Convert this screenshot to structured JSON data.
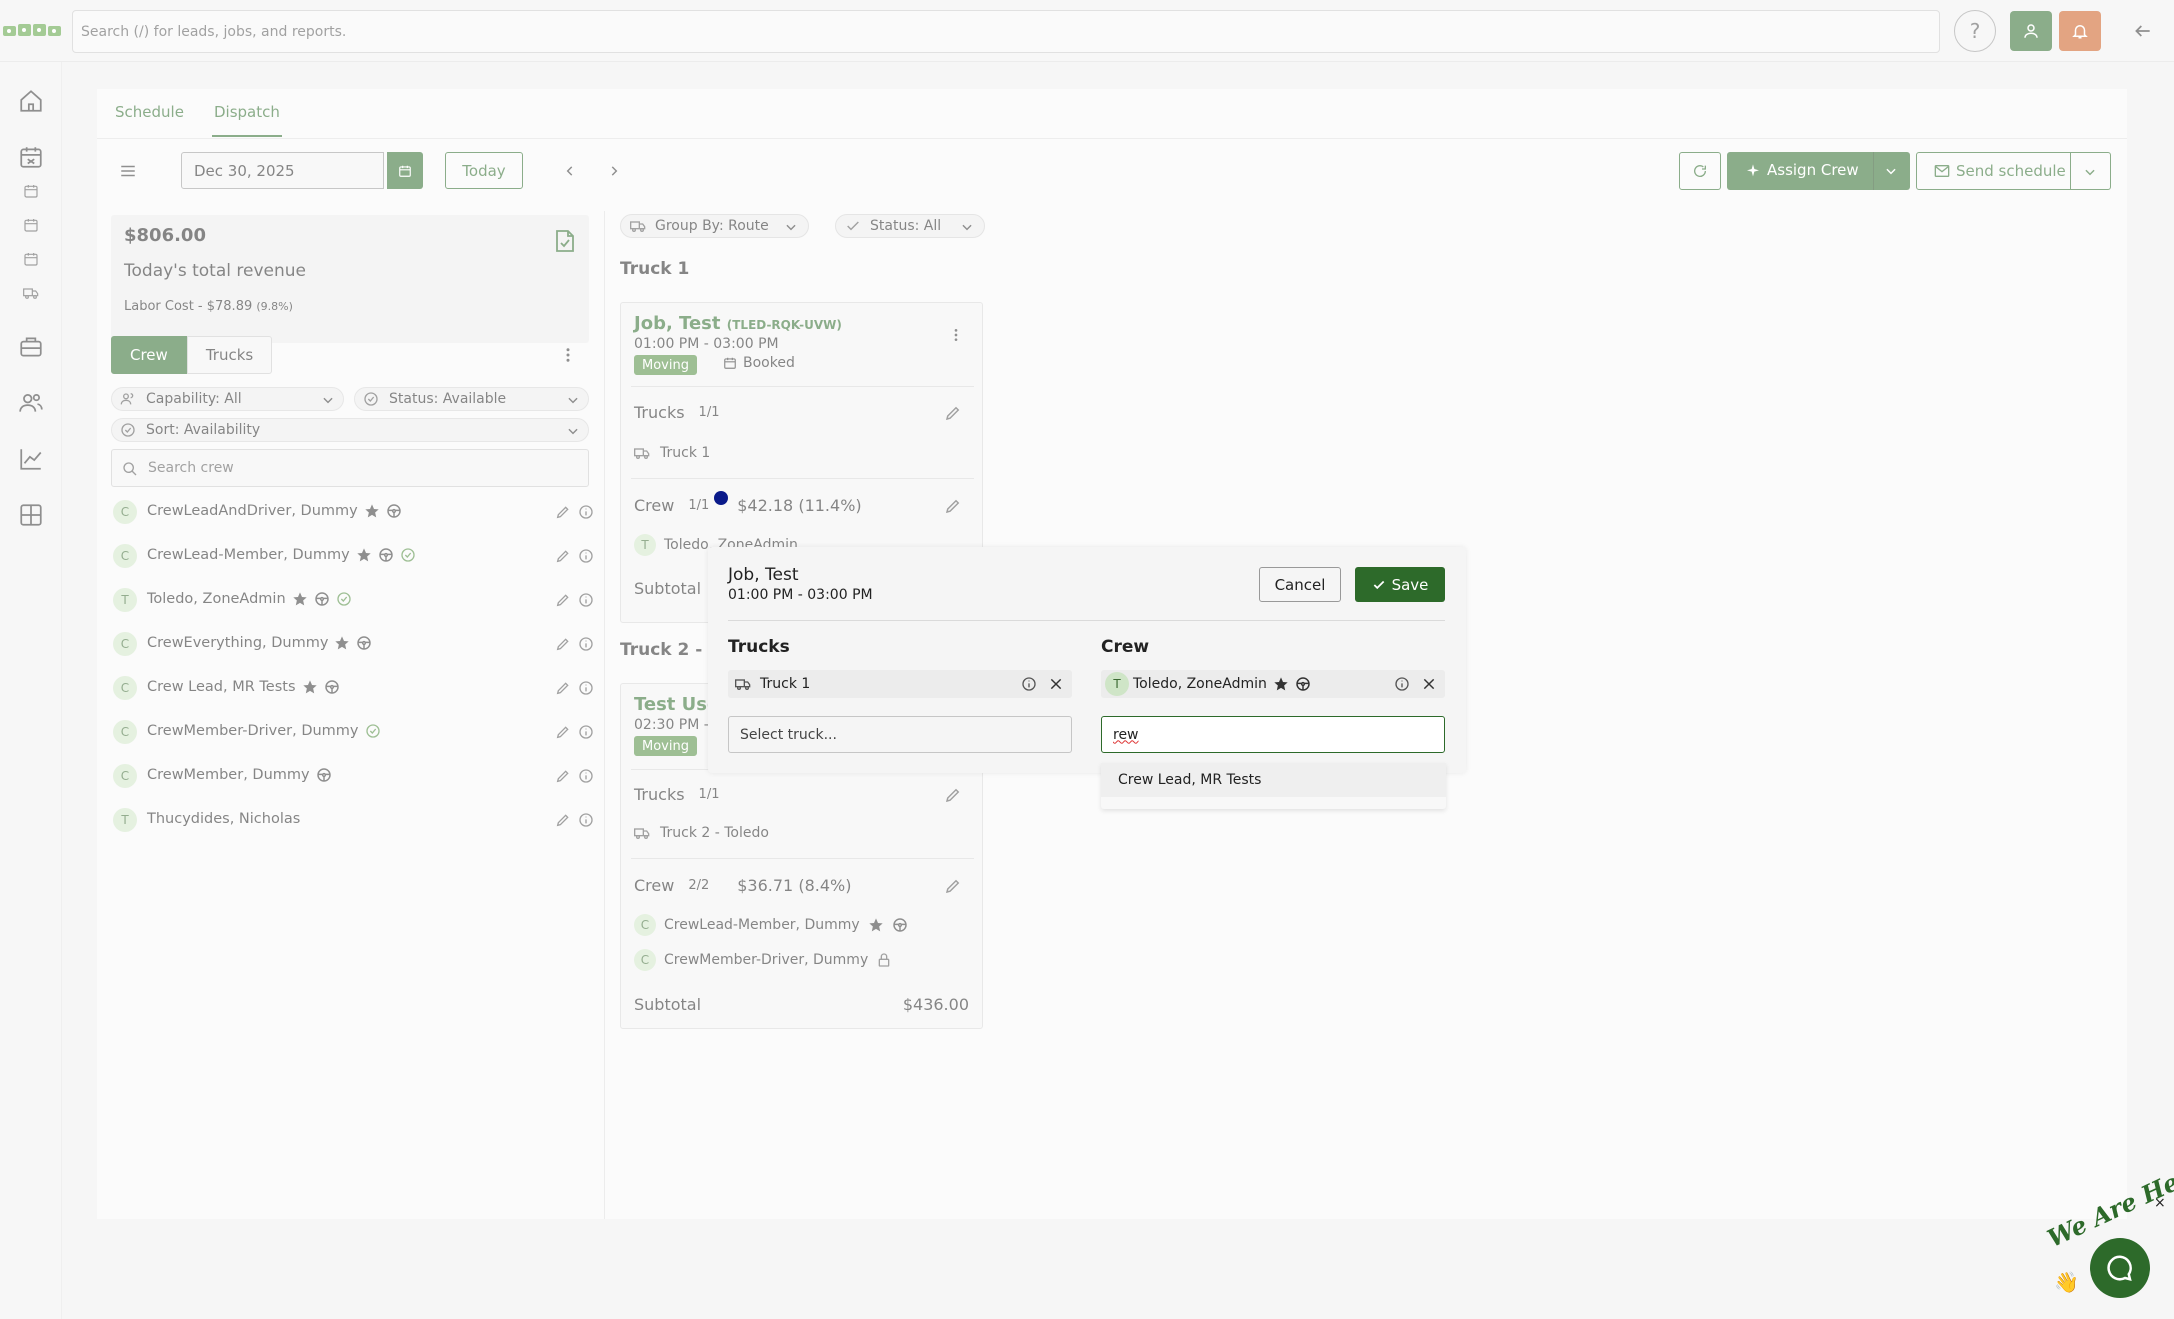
{
  "topbar": {
    "search_placeholder": "Search (/) for leads, jobs, and reports.",
    "help_label": "?"
  },
  "tabs": [
    {
      "label": "Schedule"
    },
    {
      "label": "Dispatch"
    }
  ],
  "toolbar": {
    "date": "Dec 30, 2025",
    "today_label": "Today",
    "assign_crew_label": "Assign Crew",
    "send_schedule_label": "Send schedule"
  },
  "revenue": {
    "amount": "$806.00",
    "label": "Today's total revenue",
    "labor": "Labor Cost - $78.89",
    "labor_pct": "(9.8%)"
  },
  "crew_panel": {
    "seg_crew": "Crew",
    "seg_trucks": "Trucks",
    "filter_capability": "Capability: All",
    "filter_status": "Status: Available",
    "filter_sort": "Sort: Availability",
    "search_placeholder": "Search crew",
    "members": [
      {
        "initial": "C",
        "name": "CrewLeadAndDriver, Dummy"
      },
      {
        "initial": "C",
        "name": "CrewLead-Member, Dummy"
      },
      {
        "initial": "T",
        "name": "Toledo, ZoneAdmin"
      },
      {
        "initial": "C",
        "name": "CrewEverything, Dummy"
      },
      {
        "initial": "C",
        "name": "Crew Lead, MR Tests"
      },
      {
        "initial": "C",
        "name": "CrewMember-Driver, Dummy"
      },
      {
        "initial": "C",
        "name": "CrewMember, Dummy"
      },
      {
        "initial": "T",
        "name": "Thucydides, Nicholas"
      }
    ]
  },
  "board": {
    "group_by": "Group By: Route",
    "status": "Status: All",
    "groups": [
      {
        "title": "Truck 1",
        "job_name": "Job, Test",
        "job_code": "(TLED-RQK-UVW)",
        "time": "01:00 PM - 03:00 PM",
        "tag": "Moving",
        "status": "Booked",
        "trucks_label": "Trucks",
        "trucks_count": "1/1",
        "truck": "Truck 1",
        "crew_label": "Crew",
        "crew_count": "1/1",
        "crew_cost": "$42.18 (11.4%)",
        "crew": [
          {
            "initial": "T",
            "name": "Toledo, ZoneAdmin"
          }
        ],
        "subtotal_label": "Subtotal"
      },
      {
        "title": "Truck 2 - T",
        "job_name": "Test Use",
        "time": "02:30 PM -",
        "tag": "Moving",
        "trucks_label": "Trucks",
        "trucks_count": "1/1",
        "truck": "Truck 2 - Toledo",
        "crew_label": "Crew",
        "crew_count": "2/2",
        "crew_cost": "$36.71 (8.4%)",
        "crew": [
          {
            "initial": "C",
            "name": "CrewLead-Member, Dummy"
          },
          {
            "initial": "C",
            "name": "CrewMember-Driver, Dummy"
          }
        ],
        "subtotal_label": "Subtotal",
        "subtotal": "$436.00"
      }
    ]
  },
  "modal": {
    "title": "Job, Test",
    "time": "01:00 PM - 03:00 PM",
    "cancel_label": "Cancel",
    "save_label": "Save",
    "trucks_heading": "Trucks",
    "crew_heading": "Crew",
    "selected_truck": "Truck 1",
    "selected_crew_initial": "T",
    "selected_crew": "Toledo, ZoneAdmin",
    "truck_select_placeholder": "Select truck...",
    "crew_input_value": "rew",
    "dropdown_option": "Crew Lead, MR Tests"
  },
  "chat": {
    "text": "We Are Here!",
    "close": "×"
  },
  "colors": {
    "brand_green": "#2d6a2a",
    "bell_orange": "#cc5a1c",
    "moving_tag": "#4f8a3c"
  }
}
